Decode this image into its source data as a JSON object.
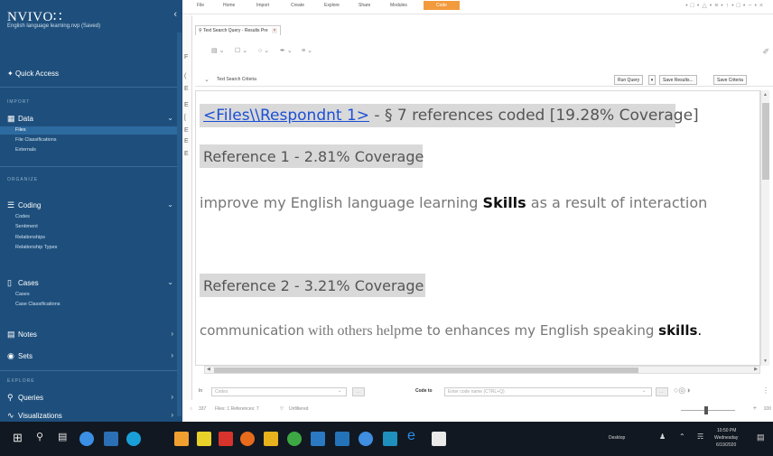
{
  "sidebar": {
    "app_name": "NVIVO∷",
    "project_name": "English language learning.nvp (Saved)",
    "quick_access": "Quick Access",
    "sections": {
      "import": "IMPORT",
      "organize": "ORGANIZE",
      "explore": "EXPLORE"
    },
    "data": {
      "label": "Data",
      "items": [
        "Files",
        "File Classifications",
        "Externals"
      ]
    },
    "coding": {
      "label": "Coding",
      "items": [
        "Codes",
        "Sentiment",
        "Relationships",
        "Relationship Types"
      ]
    },
    "cases": {
      "label": "Cases",
      "items": [
        "Cases",
        "Case Classifications"
      ]
    },
    "notes": "Notes",
    "sets": "Sets",
    "queries": "Queries",
    "visualizations": "Visualizations"
  },
  "ribbon": {
    "tabs": [
      "File",
      "Home",
      "Import",
      "Create",
      "Explore",
      "Share",
      "Modules",
      "Code"
    ],
    "active_tab": "Code",
    "accent": "#f29b3d"
  },
  "left_column": {
    "letters": [
      "F",
      "(",
      "E",
      "E",
      "[",
      "E",
      "E",
      "E"
    ]
  },
  "document": {
    "tab_title": "Text Search Query - Results Pre",
    "criteria_label": "Text Search Criteria",
    "buttons": {
      "run_query": "Run Query",
      "save_results": "Save Results...",
      "save_criteria": "Save Criteria"
    },
    "header_link": "<Files\\\\Respondnt 1>",
    "header_rest": " - § 7 references coded  [19.28% Coverage]",
    "ref1": "Reference 1 - 2.81% Coverage",
    "text1_before": "improve my English language learning ",
    "text1_bold": "Skills",
    "text1_after": " as a result of interaction",
    "ref2": "Reference 2 - 3.21% Coverage",
    "text2_part1": "communication",
    "text2_part2": " with others help",
    "text2_part3": "me to enhances my ",
    "text2_part4": "English speaking ",
    "text2_bold": "skills",
    "text2_end": "."
  },
  "code_bar": {
    "in_label": "In",
    "in_placeholder": "Codes",
    "code_to_label": "Code to",
    "code_to_placeholder": "Enter code name (CTRL+Q)"
  },
  "status": {
    "items": "337",
    "files_label": "Files: 1  References: 7",
    "filter_label": "Unfiltered",
    "zoom": "100"
  },
  "taskbar": {
    "desktop_label": "Desktop",
    "time": "10:50 PM",
    "day": "Wednesday",
    "date": "6/19/2020"
  }
}
